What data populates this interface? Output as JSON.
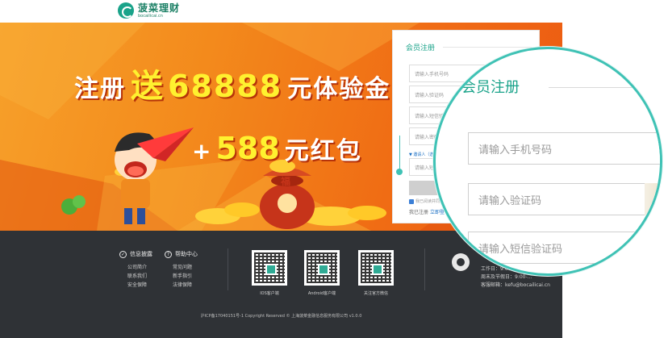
{
  "header": {
    "logo_cn": "菠菜理财",
    "logo_en": "bocailicai.cn"
  },
  "banner": {
    "headline_part1": "注册",
    "headline_part2": "送",
    "headline_part3": "68888",
    "headline_part4": "元体验金",
    "plus": "+",
    "headline_part5": "588",
    "headline_part6": "元红包",
    "coin_char": "福"
  },
  "register_form": {
    "title": "会员注册",
    "phone_placeholder": "请输入手机号码",
    "captcha_placeholder": "请输入验证码",
    "sms_placeholder": "请输入短信验证码",
    "password_placeholder": "请输入密码",
    "invite_placeholder": "请输入短信...",
    "tip": "▼ 邀请人（选填）",
    "agree_text": "我已阅读并同意《注册协议》",
    "login_prefix": "我已注册",
    "login_link": "立即登录"
  },
  "zoom_view": {
    "title": "会员注册",
    "phone_placeholder": "请输入手机号码",
    "captcha_placeholder": "请输入验证码",
    "sms_placeholder": "请输入短信验证码"
  },
  "footer": {
    "info_title": "信息披露",
    "info_links": [
      "公司简介",
      "联系我们",
      "安全保障"
    ],
    "help_title": "帮助中心",
    "help_links": [
      "常见问题",
      "新手指引",
      "法律保障"
    ],
    "qr_labels": [
      "IOS客户端",
      "Android客户端",
      "关注官方微信"
    ],
    "contact_line1": "工作日：9:00-...",
    "contact_line2": "周末及节假日：9:00-...",
    "contact_email": "客服邮箱：kefu@bocailicai.cn",
    "copyright": "沪ICP备17040151号-1 Copyright Reserved © 上海菠菜金融信息服务有限公司 v1.0.0"
  },
  "colors": {
    "brand": "#1aa38a",
    "banner_orange": "#f38a1c",
    "headline_yellow": "#fff12f",
    "footer_bg": "#2f3236",
    "zoom_border": "#3fc2b5"
  }
}
